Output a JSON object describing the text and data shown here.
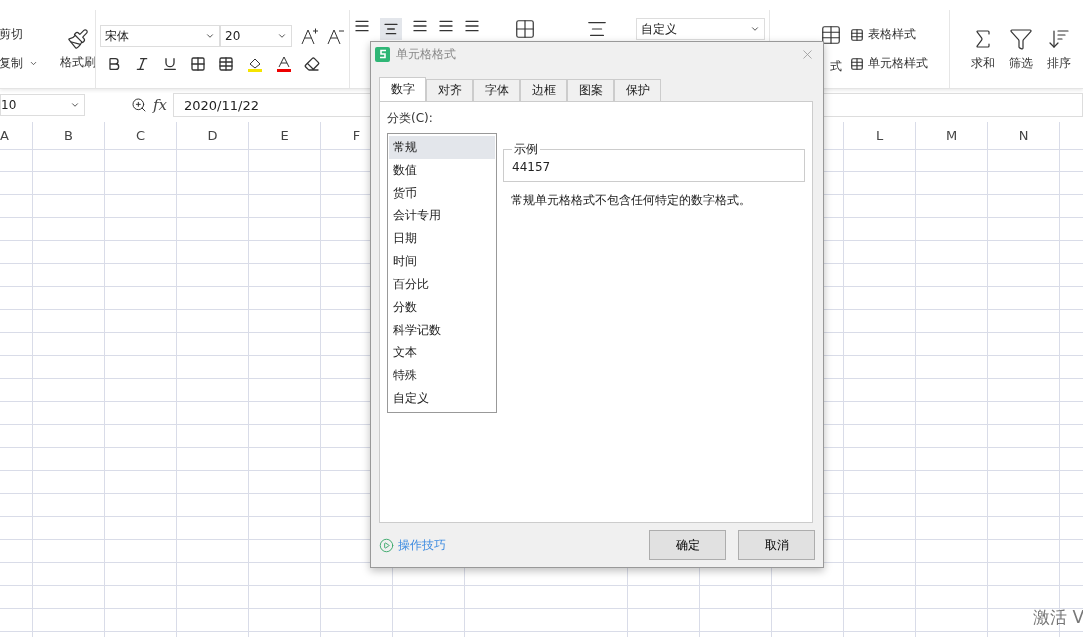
{
  "ribbon": {
    "cut": "剪切",
    "copy": "复制",
    "format_painter": "格式刷",
    "font_name": "宋体",
    "font_size": "20",
    "number_format": "自定义",
    "cut_label": "式",
    "styles": [
      "表格样式",
      "单元格样式"
    ],
    "tools": [
      "求和",
      "筛选",
      "排序"
    ]
  },
  "formula_bar": {
    "name_box": "10",
    "fx": "fx",
    "value": "2020/11/22"
  },
  "columns_left": [
    "A",
    "B",
    "C",
    "D",
    "E",
    "F"
  ],
  "columns_right": [
    "L",
    "M",
    "N"
  ],
  "dialog": {
    "title": "单元格格式",
    "tabs": [
      {
        "label": "数字",
        "selected": true
      },
      {
        "label": "对齐",
        "selected": false
      },
      {
        "label": "字体",
        "selected": false
      },
      {
        "label": "边框",
        "selected": false
      },
      {
        "label": "图案",
        "selected": false
      },
      {
        "label": "保护",
        "selected": false
      }
    ],
    "category_label": "分类(C):",
    "categories": [
      {
        "label": "常规",
        "selected": true
      },
      {
        "label": "数值",
        "selected": false
      },
      {
        "label": "货币",
        "selected": false
      },
      {
        "label": "会计专用",
        "selected": false
      },
      {
        "label": "日期",
        "selected": false
      },
      {
        "label": "时间",
        "selected": false
      },
      {
        "label": "百分比",
        "selected": false
      },
      {
        "label": "分数",
        "selected": false
      },
      {
        "label": "科学记数",
        "selected": false
      },
      {
        "label": "文本",
        "selected": false
      },
      {
        "label": "特殊",
        "selected": false
      },
      {
        "label": "自定义",
        "selected": false
      }
    ],
    "sample_label": "示例",
    "sample_value": "44157",
    "description": "常规单元格格式不包含任何特定的数字格式。",
    "tips_link": "操作技巧",
    "buttons": [
      "确定",
      "取消"
    ]
  },
  "activation_text": "激活 V"
}
